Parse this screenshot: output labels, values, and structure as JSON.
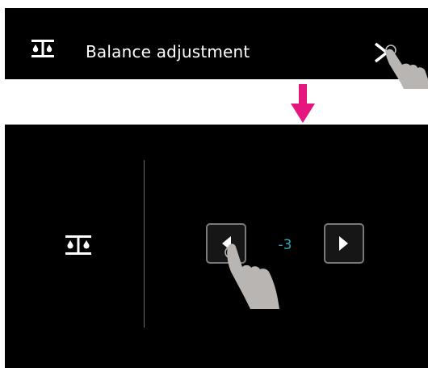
{
  "header": {
    "title": "Balance adjustment",
    "icon": "balance-icon",
    "next_icon": "chevron-right-icon"
  },
  "transition": {
    "icon": "arrow-down-icon",
    "color": "#e5177f"
  },
  "panel": {
    "icon": "balance-icon",
    "decrease_icon": "triangle-left-icon",
    "increase_icon": "triangle-right-icon",
    "balance_value": "-3",
    "value_color": "#27a9b0"
  },
  "gesture": {
    "icon": "hand-pointer-icon",
    "color": "#b9b5b2"
  }
}
